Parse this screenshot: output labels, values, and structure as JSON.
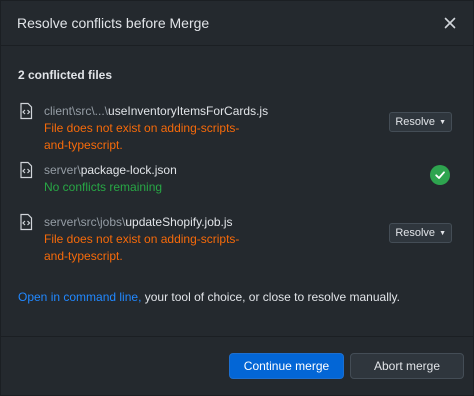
{
  "header": {
    "title": "Resolve conflicts before Merge",
    "close_icon": "close-icon"
  },
  "summary": {
    "count_label": "2 conflicted files"
  },
  "files": [
    {
      "dir": "client\\src\\...\\",
      "name": "useInventoryItemsForCards.js",
      "status_line1": "File does not exist on adding-scripts-",
      "status_line2": "and-typescript.",
      "status_type": "error",
      "action_label": "Resolve"
    },
    {
      "dir": "server\\",
      "name": "package-lock.json",
      "status_line1": "No conflicts remaining",
      "status_line2": "",
      "status_type": "ok"
    },
    {
      "dir": "server\\src\\jobs\\",
      "name": "updateShopify.job.js",
      "status_line1": "File does not exist on adding-scripts-",
      "status_line2": "and-typescript.",
      "status_type": "error",
      "action_label": "Resolve"
    }
  ],
  "footnote": {
    "link_text": "Open in command line,",
    "rest_text": " your tool of choice, or close to resolve manually."
  },
  "footer": {
    "continue_label": "Continue merge",
    "abort_label": "Abort merge"
  },
  "colors": {
    "background": "#24292e",
    "error": "#f66a0a",
    "ok": "#28a745",
    "link": "#2188ff",
    "primary": "#0366d6"
  }
}
